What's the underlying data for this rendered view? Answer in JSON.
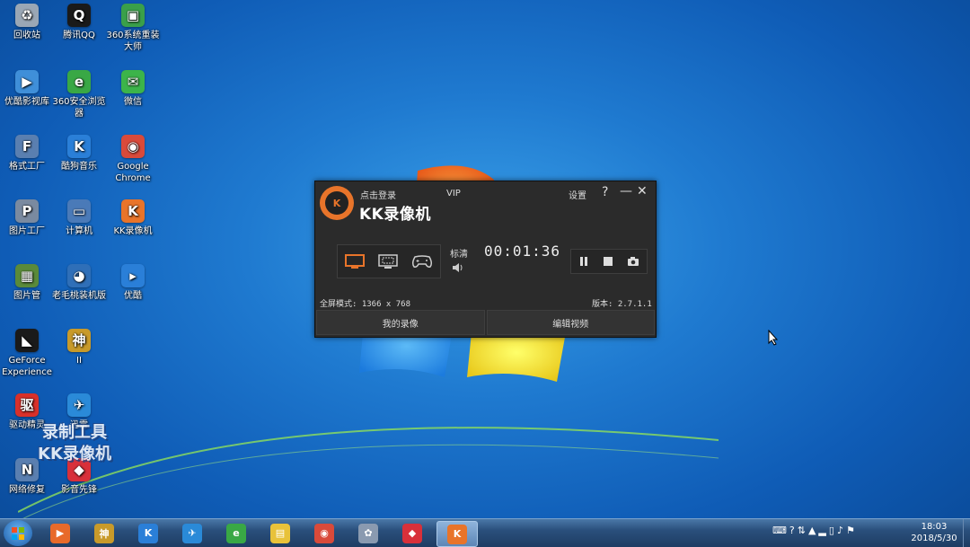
{
  "desktop": {
    "icons": [
      {
        "label": "回收站",
        "color": "#9aa7b5",
        "glyph": "♻"
      },
      {
        "label": "腾讯QQ",
        "color": "#1a1a1a",
        "glyph": "Q"
      },
      {
        "label": "360系统重装大师",
        "color": "#3aa04a",
        "glyph": "▣"
      },
      {
        "label": "优酷影视库",
        "color": "#3f8fd9",
        "glyph": "▶"
      },
      {
        "label": "360安全浏览器",
        "color": "#39a845",
        "glyph": "e"
      },
      {
        "label": "微信",
        "color": "#3cb44a",
        "glyph": "✉"
      },
      {
        "label": "格式工厂",
        "color": "#5a7fb0",
        "glyph": "F"
      },
      {
        "label": "酷狗音乐",
        "color": "#2a7fd8",
        "glyph": "K"
      },
      {
        "label": "Google Chrome",
        "color": "#d94a3a",
        "glyph": "◉"
      },
      {
        "label": "图片工厂",
        "color": "#7a8aa0",
        "glyph": "P"
      },
      {
        "label": "计算机",
        "color": "#4a7ab8",
        "glyph": "▭"
      },
      {
        "label": "KK录像机",
        "color": "#e8742a",
        "glyph": "K"
      },
      {
        "label": "图片管",
        "color": "#5a8a3a",
        "glyph": "▦"
      },
      {
        "label": "老毛桃装机版",
        "color": "#2f6fb8",
        "glyph": "◕"
      },
      {
        "label": "优酷",
        "color": "#2a7fd8",
        "glyph": "▸"
      },
      {
        "label": "GeForce Experience",
        "color": "#1a1a1a",
        "glyph": "◣"
      },
      {
        "label": "II",
        "color": "#c89a2a",
        "glyph": "神"
      },
      {
        "label": "驱动精灵",
        "color": "#d8302a",
        "glyph": "驱"
      },
      {
        "label": "迅雷",
        "color": "#2a8ad8",
        "glyph": "✈"
      },
      {
        "label": "网络修复",
        "color": "#5a7fb0",
        "glyph": "N"
      },
      {
        "label": "影音先锋",
        "color": "#d8303a",
        "glyph": "◆"
      }
    ],
    "watermark": {
      "line1": "录制工具",
      "line2": "KK录像机"
    }
  },
  "kk_window": {
    "login": "点击登录",
    "app_name": "KK录像机",
    "logo_letter": "K",
    "vip": "VIP",
    "settings": "设置",
    "help": "?",
    "minimize": "—",
    "close": "✕",
    "quality": "标清",
    "timer": "00:01:36",
    "fullscreen_mode": "全屏模式: 1366 x 768",
    "version": "版本: 2.7.1.1",
    "tab_my_recordings": "我的录像",
    "tab_edit_video": "编辑视频",
    "accent_color": "#e8742a"
  },
  "taskbar": {
    "items": [
      {
        "glyph": "▶",
        "color": "#e86a2a"
      },
      {
        "glyph": "神",
        "color": "#c89a2a"
      },
      {
        "glyph": "K",
        "color": "#2a7fd8"
      },
      {
        "glyph": "✈",
        "color": "#2a8ad8"
      },
      {
        "glyph": "e",
        "color": "#39a845"
      },
      {
        "glyph": "▤",
        "color": "#e8c23a"
      },
      {
        "glyph": "◉",
        "color": "#d94a3a"
      },
      {
        "glyph": "✿",
        "color": "#8a9ab0"
      },
      {
        "glyph": "◆",
        "color": "#d8303a"
      },
      {
        "glyph": "K",
        "color": "#e8742a"
      }
    ],
    "time": "18:03",
    "date": "2018/5/30"
  }
}
